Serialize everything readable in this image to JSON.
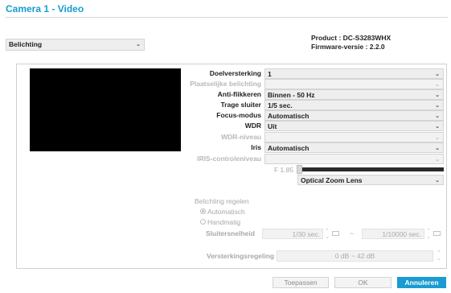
{
  "window": {
    "title": "Camera 1 - Video"
  },
  "category_select": {
    "value": "Belichting"
  },
  "info": {
    "product": "Product : DC-S3283WHX",
    "firmware": "Firmware-versie : 2.2.0"
  },
  "settings": {
    "doelversterking": {
      "label": "Doelversterking",
      "value": "1"
    },
    "plaatselijke": {
      "label": "Plaatselijke belichting",
      "value": ""
    },
    "anti_flikkeren": {
      "label": "Anti-flikkeren",
      "value": "Binnen - 50 Hz"
    },
    "trage_sluiter": {
      "label": "Trage sluiter",
      "value": "1/5 sec."
    },
    "focus_modus": {
      "label": "Focus-modus",
      "value": "Automatisch"
    },
    "wdr": {
      "label": "WDR",
      "value": "Uit"
    },
    "wdr_niveau": {
      "label": "WDR-niveau",
      "value": ""
    },
    "iris": {
      "label": "Iris",
      "value": "Automatisch"
    },
    "iris_control": {
      "label": "IRIS-controleniveau",
      "value": ""
    }
  },
  "f_number": {
    "label": "F 1.85",
    "level": 0
  },
  "lens": {
    "value": "Optical Zoom Lens"
  },
  "exposure": {
    "heading": "Belichting regelen",
    "auto_label": "Automatisch",
    "manual_label": "Handmatig",
    "selected": "Automatisch",
    "shutter_label": "Sluitersnelheid",
    "shutter_min": "1/30 sec.",
    "shutter_sep": "~",
    "shutter_max": "1/10000 sec.",
    "gain_label": "Versterkingsregeling",
    "gain_value": "0 dB ~ 42 dB"
  },
  "buttons": {
    "apply": "Toepassen",
    "ok": "OK",
    "cancel": "Annuleren"
  },
  "colors": {
    "accent": "#1a9bd1",
    "preview": "#000000"
  },
  "icons": {
    "dropdown": "chevron-down-icon",
    "spinner": "spinner-arrows-icon",
    "keyboard": "keyboard-icon"
  }
}
